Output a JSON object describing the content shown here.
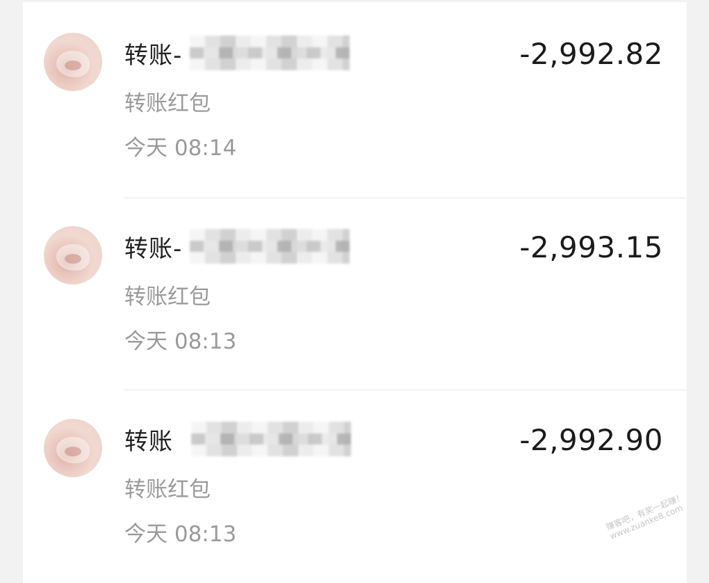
{
  "transactions": [
    {
      "title_prefix": "转账-",
      "category": "转账红包",
      "time": "今天 08:14",
      "amount": "-2,992.82"
    },
    {
      "title_prefix": "转账-",
      "category": "转账红包",
      "time": "今天 08:13",
      "amount": "-2,993.15"
    },
    {
      "title_prefix": "转账",
      "category": "转账红包",
      "time": "今天 08:13",
      "amount": "-2,992.90"
    }
  ],
  "watermark": {
    "line1": "赚客吧，有奖一起赚！",
    "line2": "www.zuanke8.com"
  },
  "icons": {
    "avatar": "avatar-image"
  }
}
